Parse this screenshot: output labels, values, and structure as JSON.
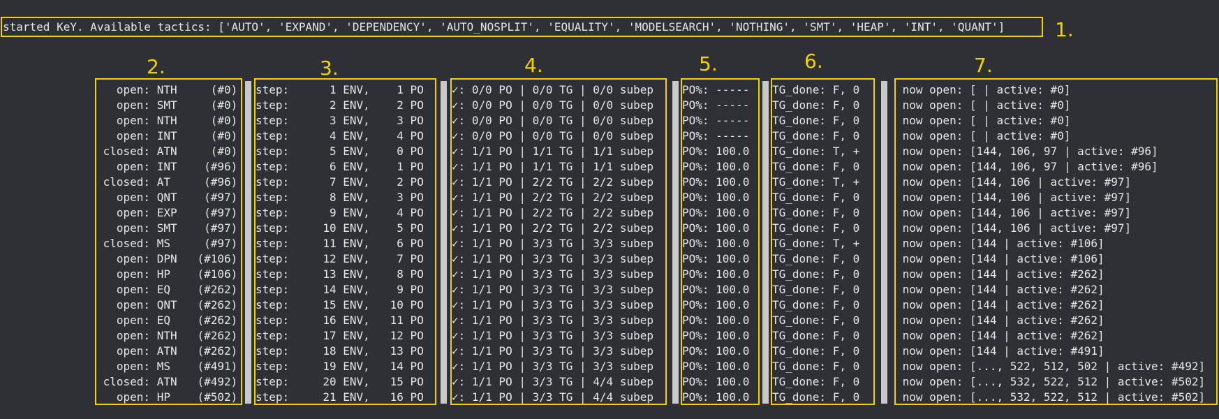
{
  "header": {
    "text": "started KeY. Available tactics: ['AUTO', 'EXPAND', 'DEPENDENCY', 'AUTO_NOSPLIT', 'EQUALITY', 'MODELSEARCH', 'NOTHING', 'SMT', 'HEAP', 'INT', 'QUANT']",
    "marker": "1."
  },
  "markers": [
    "2.",
    "3.",
    "4.",
    "5.",
    "6.",
    "7."
  ],
  "accent_color": "#f3d200",
  "background_color": "#2e3036",
  "text_color": "#e6e6e6",
  "columns": {
    "status": [
      "   open: NTH     (#0)",
      "   open: SMT     (#0)",
      "   open: NTH     (#0)",
      "   open: INT     (#0)",
      " closed: ATN     (#0)",
      "   open: INT    (#96)",
      " closed: AT     (#96)",
      "   open: QNT    (#97)",
      "   open: EXP    (#97)",
      "   open: SMT    (#97)",
      " closed: MS     (#97)",
      "   open: DPN   (#106)",
      "   open: HP    (#106)",
      "   open: EQ    (#262)",
      "   open: QNT   (#262)",
      "   open: EQ    (#262)",
      "   open: NTH   (#262)",
      "   open: ATN   (#262)",
      "   open: MS    (#491)",
      " closed: ATN   (#492)",
      "   open: HP    (#502)"
    ],
    "steps": [
      "step:      1 ENV,    1 PO",
      "step:      2 ENV,    2 PO",
      "step:      3 ENV,    3 PO",
      "step:      4 ENV,    4 PO",
      "step:      5 ENV,    0 PO",
      "step:      6 ENV,    1 PO",
      "step:      7 ENV,    2 PO",
      "step:      8 ENV,    3 PO",
      "step:      9 ENV,    4 PO",
      "step:     10 ENV,    5 PO",
      "step:     11 ENV,    6 PO",
      "step:     12 ENV,    7 PO",
      "step:     13 ENV,    8 PO",
      "step:     14 ENV,    9 PO",
      "step:     15 ENV,   10 PO",
      "step:     16 ENV,   11 PO",
      "step:     17 ENV,   12 PO",
      "step:     18 ENV,   13 PO",
      "step:     19 ENV,   14 PO",
      "step:     20 ENV,   15 PO",
      "step:     21 ENV,   16 PO"
    ],
    "checks": [
      "✓: 0/0 PO | 0/0 TG | 0/0 subep",
      "✓: 0/0 PO | 0/0 TG | 0/0 subep",
      "✓: 0/0 PO | 0/0 TG | 0/0 subep",
      "✓: 0/0 PO | 0/0 TG | 0/0 subep",
      "✓: 1/1 PO | 1/1 TG | 1/1 subep",
      "✓: 1/1 PO | 1/1 TG | 1/1 subep",
      "✓: 1/1 PO | 2/2 TG | 2/2 subep",
      "✓: 1/1 PO | 2/2 TG | 2/2 subep",
      "✓: 1/1 PO | 2/2 TG | 2/2 subep",
      "✓: 1/1 PO | 2/2 TG | 2/2 subep",
      "✓: 1/1 PO | 3/3 TG | 3/3 subep",
      "✓: 1/1 PO | 3/3 TG | 3/3 subep",
      "✓: 1/1 PO | 3/3 TG | 3/3 subep",
      "✓: 1/1 PO | 3/3 TG | 3/3 subep",
      "✓: 1/1 PO | 3/3 TG | 3/3 subep",
      "✓: 1/1 PO | 3/3 TG | 3/3 subep",
      "✓: 1/1 PO | 3/3 TG | 3/3 subep",
      "✓: 1/1 PO | 3/3 TG | 3/3 subep",
      "✓: 1/1 PO | 3/3 TG | 3/3 subep",
      "✓: 1/1 PO | 3/3 TG | 4/4 subep",
      "✓: 1/1 PO | 3/3 TG | 4/4 subep"
    ],
    "po_percent": [
      "PO%: -----",
      "PO%: -----",
      "PO%: -----",
      "PO%: -----",
      "PO%: 100.0",
      "PO%: 100.0",
      "PO%: 100.0",
      "PO%: 100.0",
      "PO%: 100.0",
      "PO%: 100.0",
      "PO%: 100.0",
      "PO%: 100.0",
      "PO%: 100.0",
      "PO%: 100.0",
      "PO%: 100.0",
      "PO%: 100.0",
      "PO%: 100.0",
      "PO%: 100.0",
      "PO%: 100.0",
      "PO%: 100.0",
      "PO%: 100.0"
    ],
    "tg_done": [
      "TG_done: F, 0",
      "TG_done: F, 0",
      "TG_done: F, 0",
      "TG_done: F, 0",
      "TG_done: T, +",
      "TG_done: F, 0",
      "TG_done: T, +",
      "TG_done: F, 0",
      "TG_done: F, 0",
      "TG_done: F, 0",
      "TG_done: T, +",
      "TG_done: F, 0",
      "TG_done: F, 0",
      "TG_done: F, 0",
      "TG_done: F, 0",
      "TG_done: F, 0",
      "TG_done: F, 0",
      "TG_done: F, 0",
      "TG_done: F, 0",
      "TG_done: F, 0",
      "TG_done: F, 0"
    ],
    "now_open": [
      " now open: [ | active: #0]",
      " now open: [ | active: #0]",
      " now open: [ | active: #0]",
      " now open: [ | active: #0]",
      " now open: [144, 106, 97 | active: #96]",
      " now open: [144, 106, 97 | active: #96]",
      " now open: [144, 106 | active: #97]",
      " now open: [144, 106 | active: #97]",
      " now open: [144, 106 | active: #97]",
      " now open: [144, 106 | active: #97]",
      " now open: [144 | active: #106]",
      " now open: [144 | active: #106]",
      " now open: [144 | active: #262]",
      " now open: [144 | active: #262]",
      " now open: [144 | active: #262]",
      " now open: [144 | active: #262]",
      " now open: [144 | active: #262]",
      " now open: [144 | active: #491]",
      " now open: [..., 522, 512, 502 | active: #492]",
      " now open: [..., 532, 522, 512 | active: #502]",
      " now open: [..., 532, 522, 512 | active: #502]"
    ]
  }
}
